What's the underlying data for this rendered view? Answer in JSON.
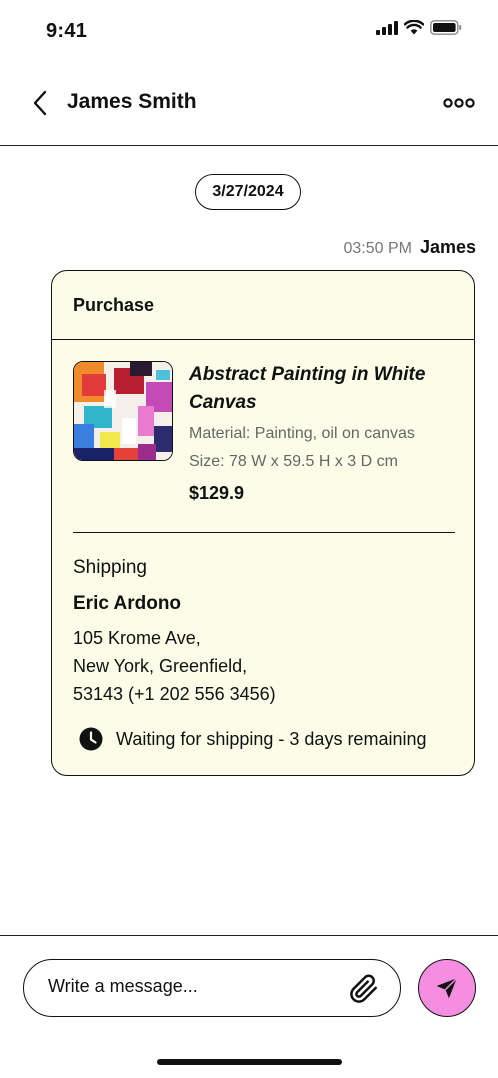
{
  "status_bar": {
    "time": "9:41"
  },
  "header": {
    "title": "James Smith",
    "back_icon": "chevron-left-icon",
    "more_icon": "more-horizontal-icon"
  },
  "chat": {
    "date": "3/27/2024",
    "message_time": "03:50 PM",
    "message_sender": "James"
  },
  "purchase_card": {
    "title": "Purchase",
    "background": "#fcfde8",
    "product": {
      "name": "Abstract Painting in White Canvas",
      "material": "Material: Painting, oil on canvas",
      "size": "Size: 78 W x 59.5 H x 3 D cm",
      "price": "$129.9"
    },
    "shipping": {
      "label": "Shipping",
      "name": "Eric Ardono",
      "address_line1": "105 Krome Ave,",
      "address_line2": "New York, Greenfield,",
      "address_line3": "53143 (+1 202 556 3456)",
      "status": "Waiting for shipping - 3 days remaining"
    }
  },
  "composer": {
    "placeholder": "Write a message...",
    "send_color": "#f58ee0"
  }
}
